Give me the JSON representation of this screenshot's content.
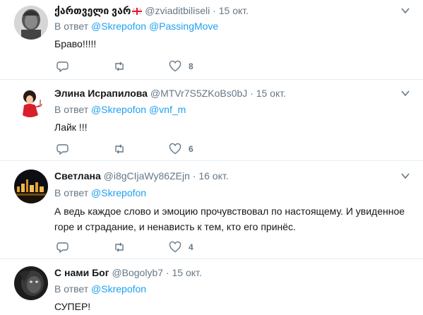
{
  "tweets": [
    {
      "name": "ქართველი ვარ",
      "handle": "@zviaditbiliseli",
      "sep": "·",
      "date": "15 окт.",
      "reply_prefix": "В ответ",
      "mentions": [
        "@Skrepofon",
        "@PassingMove"
      ],
      "text": "Браво!!!!!",
      "likes": "8",
      "has_flag": true
    },
    {
      "name": "Элина Исрапилова",
      "handle": "@MTVr7S5ZKoBs0bJ",
      "sep": "·",
      "date": "15 окт.",
      "reply_prefix": "В ответ",
      "mentions": [
        "@Skrepofon",
        "@vnf_m"
      ],
      "text": "Лайк !!!",
      "likes": "6"
    },
    {
      "name": "Светлана",
      "handle": "@i8gCIjaWy86ZEjn",
      "sep": "·",
      "date": "16 окт.",
      "reply_prefix": "В ответ",
      "mentions": [
        "@Skrepofon"
      ],
      "text": "А ведь каждое слово и эмоцию прочувствовал по настоящему. И увиденное горе и страдание, и ненависть к тем, кто его принёс.",
      "likes": "4"
    },
    {
      "name": "С нами Бог",
      "handle": "@Bogolyb7",
      "sep": "·",
      "date": "15 окт.",
      "reply_prefix": "В ответ",
      "mentions": [
        "@Skrepofon"
      ],
      "text": "СУПЕР!"
    }
  ],
  "colors": {
    "link": "#1da1f2",
    "secondary": "#657786",
    "text": "#14171a",
    "separator": "#e6ecf0"
  },
  "icons": [
    "reply-icon",
    "retweet-icon",
    "like-icon",
    "caret-down-icon"
  ]
}
